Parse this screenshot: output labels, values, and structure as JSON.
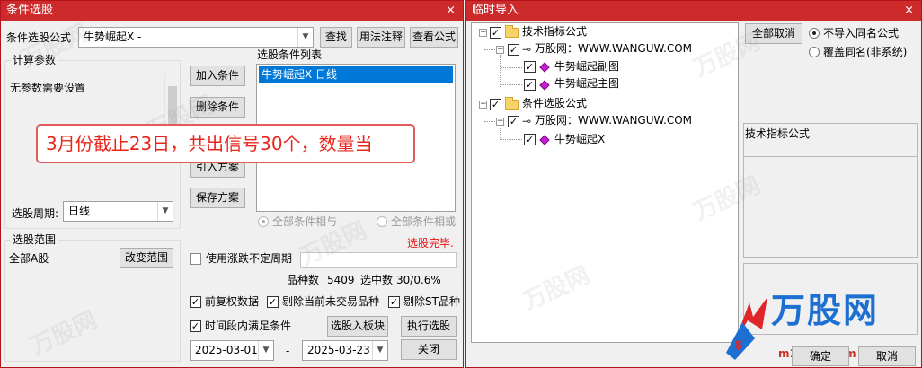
{
  "left": {
    "title": "条件选股",
    "close_glyph": "×",
    "formula_label": "条件选股公式",
    "formula_value": "牛势崛起X  -",
    "find_btn": "查找",
    "usage_btn": "用法注释",
    "view_btn": "查看公式",
    "calc_group": "计算参数",
    "no_param_text": "无参数需要设置",
    "period_label": "选股周期:",
    "period_value": "日线",
    "scope_group": "选股范围",
    "scope_value": "全部A股",
    "change_scope_btn": "改变范围",
    "add_cond_btn": "加入条件",
    "del_cond_btn": "删除条件",
    "import_plan_btn": "引入方案",
    "save_plan_btn": "保存方案",
    "cond_list_label": "选股条件列表",
    "cond_items": [
      "牛势崛起X  日线"
    ],
    "radio_and": "全部条件相与",
    "radio_or": "全部条件相或",
    "status_done": "选股完毕.",
    "use_flex_label": "使用涨跌不定周期",
    "variety_label": "品种数",
    "variety_value": "5409",
    "selected_label": "选中数",
    "selected_value": "30/0.6%",
    "pre_adjust_label": "前复权数据",
    "remove_untraded_label": "剔除当前未交易品种",
    "remove_st_label": "剔除ST品种",
    "period_satisfy_label": "时间段内满足条件",
    "to_board_btn": "选股入板块",
    "run_btn": "执行选股",
    "date_from": "2025-03-01",
    "date_sep": "-",
    "date_to": "2025-03-23",
    "close_btn": "关闭",
    "callout": "3月份截止23日，共出信号30个，数量当"
  },
  "right": {
    "title": "临时导入",
    "close_glyph": "×",
    "tree": {
      "tech_folder": "技术指标公式",
      "tech_site": "万股网：WWW.WANGUW.COM",
      "tech_items": [
        "牛势崛起副图",
        "牛势崛起主图"
      ],
      "cond_folder": "条件选股公式",
      "cond_site": "万股网：WWW.WANGUW.COM",
      "cond_items": [
        "牛势崛起X"
      ]
    },
    "cancel_all_btn": "全部取消",
    "opt_no_import": "不导入同名公式",
    "opt_overwrite": "覆盖同名(非系统)",
    "info_label": "技术指标公式",
    "ok_btn": "确定",
    "cancel_btn": "取消",
    "logo_text": "万股网",
    "logo_sub": "m11082.com"
  },
  "colors": {
    "title_bar": "#cd2a2b",
    "selection": "#0078d7",
    "callout_text": "#e8251b",
    "status_red": "#e81010",
    "logo_blue": "#1d6fd1",
    "logo_red": "#e0262b"
  }
}
